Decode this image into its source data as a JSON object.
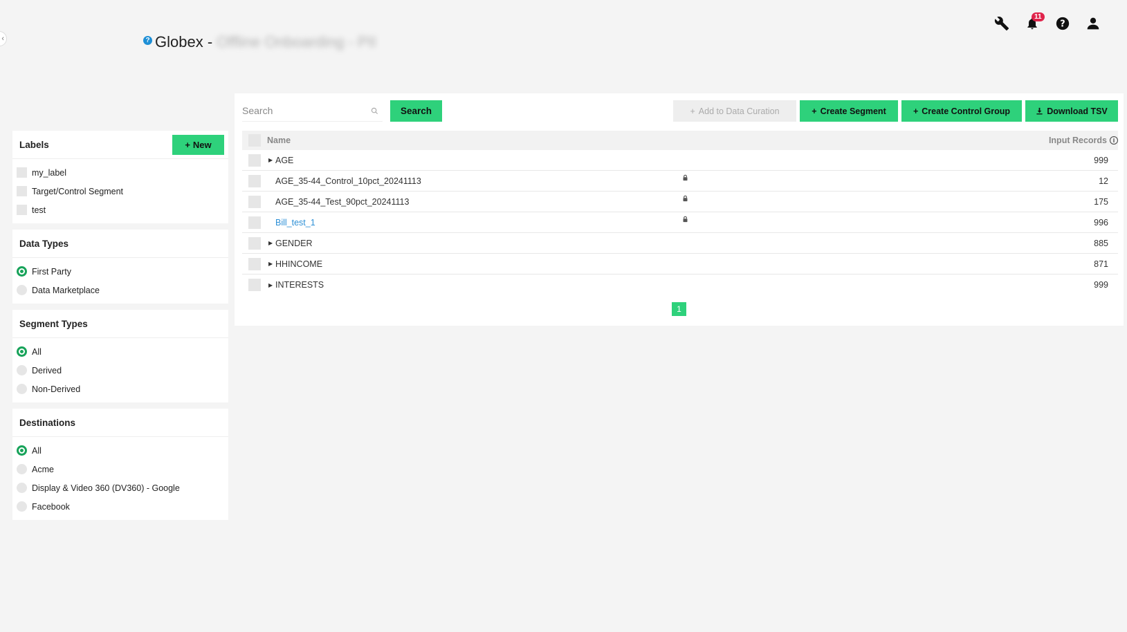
{
  "header": {
    "title": "Globex -",
    "title_obscured": "Offline Onboarding - PII",
    "help_glyph": "?",
    "notifications_count": "11"
  },
  "icons": {
    "wrench": "wrench-icon",
    "bell": "bell-icon",
    "help": "help-icon",
    "user": "user-icon"
  },
  "sidebar": {
    "labels": {
      "title": "Labels",
      "new_label": "New",
      "items": [
        "my_label",
        "Target/Control Segment",
        "test"
      ]
    },
    "data_types": {
      "title": "Data Types",
      "items": [
        "First Party",
        "Data Marketplace"
      ],
      "selected": "First Party"
    },
    "segment_types": {
      "title": "Segment Types",
      "items": [
        "All",
        "Derived",
        "Non-Derived"
      ],
      "selected": "All"
    },
    "destinations": {
      "title": "Destinations",
      "items": [
        "All",
        "Acme",
        "Display & Video 360 (DV360) - Google",
        "Facebook"
      ],
      "selected": "All"
    }
  },
  "toolbar": {
    "search_placeholder": "Search",
    "search_label": "Search",
    "add_curation_label": "Add to Data Curation",
    "create_segment_label": "Create Segment",
    "create_control_label": "Create Control Group",
    "download_label": "Download TSV"
  },
  "table": {
    "columns": {
      "name": "Name",
      "records": "Input Records"
    },
    "rows": [
      {
        "name": "AGE",
        "records": "999",
        "expandable": true,
        "locked": false,
        "link": false
      },
      {
        "name": "AGE_35-44_Control_10pct_20241113",
        "records": "12",
        "expandable": false,
        "locked": true,
        "link": false
      },
      {
        "name": "AGE_35-44_Test_90pct_20241113",
        "records": "175",
        "expandable": false,
        "locked": true,
        "link": false
      },
      {
        "name": "Bill_test_1",
        "records": "996",
        "expandable": false,
        "locked": true,
        "link": true
      },
      {
        "name": "GENDER",
        "records": "885",
        "expandable": true,
        "locked": false,
        "link": false
      },
      {
        "name": "HHINCOME",
        "records": "871",
        "expandable": true,
        "locked": false,
        "link": false
      },
      {
        "name": "INTERESTS",
        "records": "999",
        "expandable": true,
        "locked": false,
        "link": false
      }
    ]
  },
  "pagination": {
    "current_page": "1"
  },
  "colors": {
    "accent": "#2ed17b",
    "radio": "#18a35a",
    "badge": "#e0244b",
    "link": "#2c8fd6"
  }
}
